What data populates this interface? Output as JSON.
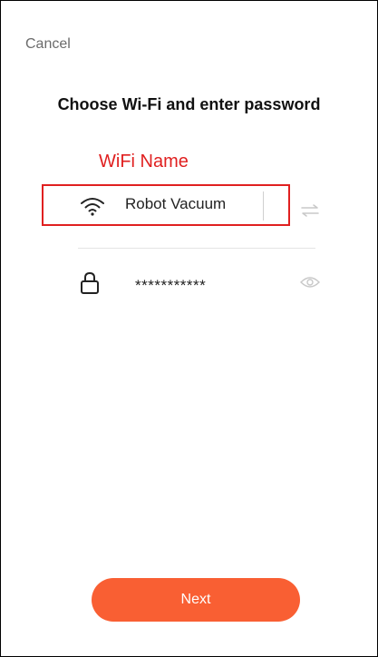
{
  "header": {
    "cancel_label": "Cancel",
    "title": "Choose Wi-Fi and enter password"
  },
  "annotation": {
    "label": "WiFi Name",
    "color": "#e02020"
  },
  "wifi": {
    "icon": "wifi-icon",
    "name": "Robot Vacuum",
    "switch_icon": "switch-network-icon"
  },
  "password": {
    "icon": "lock-icon",
    "value": "***********",
    "toggle_icon": "eye-icon"
  },
  "footer": {
    "next_label": "Next",
    "accent_color": "#f95f33"
  }
}
